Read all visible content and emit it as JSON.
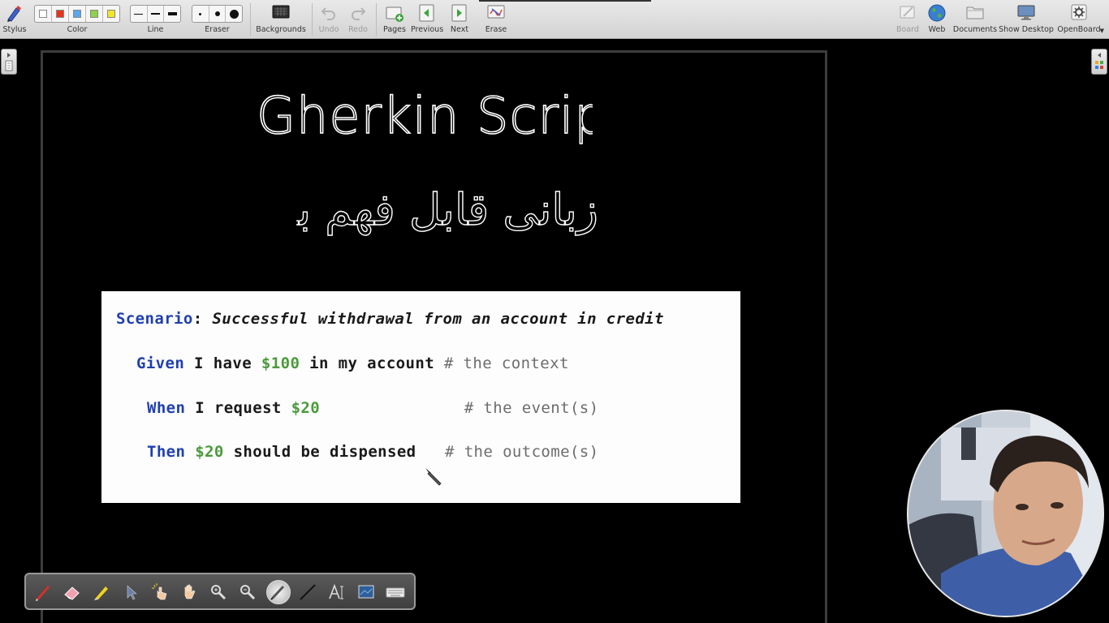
{
  "toolbar": {
    "stylus": "Stylus",
    "color": "Color",
    "line": "Line",
    "eraser": "Eraser",
    "backgrounds": "Backgrounds",
    "undo": "Undo",
    "redo": "Redo",
    "pages": "Pages",
    "previous": "Previous",
    "next": "Next",
    "erase": "Erase",
    "board": "Board",
    "web": "Web",
    "documents": "Documents",
    "show_desktop": "Show Desktop",
    "openboard": "OpenBoard"
  },
  "colors": {
    "swatches": [
      "#ffffff",
      "#e8341c",
      "#5aa8e8",
      "#8ed14a",
      "#f2e52a"
    ],
    "keyword": "#1f3fb0",
    "money": "#4a9a3a",
    "comment": "#6d6d6d"
  },
  "board": {
    "handwritten_title": "Gherkin Script",
    "handwritten_subtitle": "زبانی قابل فهم برای همه"
  },
  "code": {
    "scenario_kw": "Scenario",
    "scenario_colon": ":",
    "scenario_text": " Successful withdrawal from an account in credit",
    "given_kw": "Given",
    "given_pre": " I have ",
    "given_money": "$100",
    "given_post": " in my account ",
    "given_comment": "# the context",
    "when_kw": "When",
    "when_pre": " I request ",
    "when_money": "$20",
    "when_pad": "               ",
    "when_comment": "# the event(s)",
    "then_kw": "Then",
    "then_pre": " ",
    "then_money": "$20",
    "then_post": " should be dispensed   ",
    "then_comment": "# the outcome(s)"
  },
  "palette": {
    "tools": [
      "pen-icon",
      "eraser-icon",
      "marker-icon",
      "selector-icon",
      "interactive-icon",
      "hand-icon",
      "zoom-in-icon",
      "zoom-out-icon",
      "laser-pointer-icon",
      "line-icon",
      "text-icon",
      "capture-icon",
      "keyboard-icon"
    ],
    "active_tool": "laser-pointer-icon"
  }
}
